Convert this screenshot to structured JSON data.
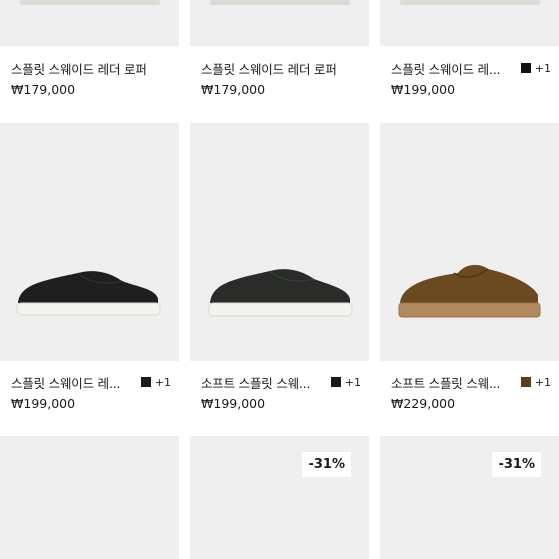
{
  "row1": [
    {
      "name": "스플릿 스웨이드 레더 로퍼",
      "price": "₩179,000"
    },
    {
      "name": "스플릿 스웨이드 레더 로퍼",
      "price": "₩179,000"
    },
    {
      "name": "스플릿 스웨이드 레...",
      "price": "₩199,000",
      "swatch_color": "#111111",
      "more_colors": "+1"
    }
  ],
  "row2": [
    {
      "name": "스플릿 스웨이드 레...",
      "price": "₩199,000",
      "swatch_color": "#1a1a1a",
      "more_colors": "+1",
      "shoe_color": "#1f1f1f"
    },
    {
      "name": "소프트 스플릿 스웨...",
      "price": "₩199,000",
      "swatch_color": "#1a1a1a",
      "more_colors": "+1",
      "shoe_color": "#2a2c2a"
    },
    {
      "name": "소프트 스플릿 스웨...",
      "price": "₩229,000",
      "swatch_color": "#5a3f1a",
      "more_colors": "+1",
      "shoe_color": "#6b4a22"
    }
  ],
  "row3": [
    {
      "badge": ""
    },
    {
      "badge": "-31%"
    },
    {
      "badge": "-31%"
    }
  ],
  "icons": {
    "shoe": "shoe-image",
    "swatch": "color-swatch"
  }
}
